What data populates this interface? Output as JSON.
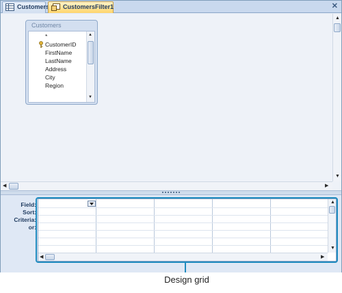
{
  "tabs": [
    {
      "label": "Customers",
      "icon": "table-icon",
      "active": false
    },
    {
      "label": "CustomersFilter1",
      "icon": "filter-query-icon",
      "active": true
    }
  ],
  "close_symbol": "✕",
  "table_box": {
    "title": "Customers",
    "fields": [
      "*",
      "CustomerID",
      "FirstName",
      "LastName",
      "Address",
      "City",
      "Region"
    ],
    "primary_key_field": "CustomerID"
  },
  "design_grid": {
    "row_labels": [
      "Field:",
      "Sort:",
      "Criteria:",
      "or:"
    ],
    "column_count": 5
  },
  "callout": {
    "label": "Design grid"
  },
  "colors": {
    "accent": "#1f8bbf",
    "active_tab": "#ffd56b",
    "panel": "#dfe8f5"
  }
}
